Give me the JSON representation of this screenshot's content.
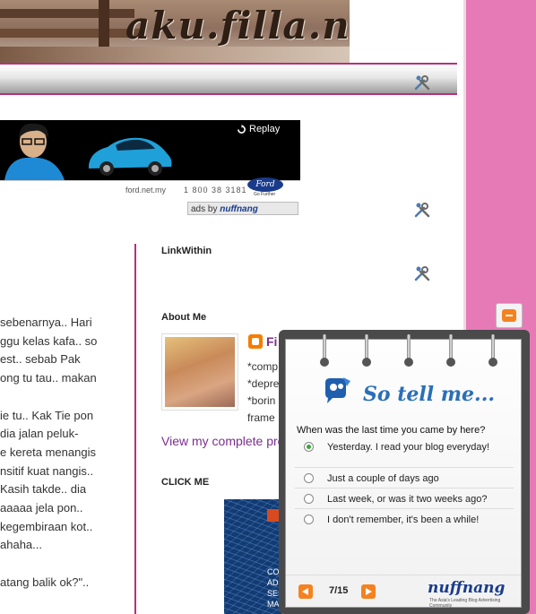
{
  "blog": {
    "title": "aku.filla.nie"
  },
  "ad": {
    "replay_label": "Replay",
    "site": "ford.net.my",
    "phone": "1 800 38 3181",
    "brand": "Ford",
    "tagline": "Go Further",
    "ads_by_prefix": "ads by",
    "ads_by_brand": "nuffnang"
  },
  "post": {
    "lines": [
      "sebenarnya.. Hari",
      "ggu kelas kafa.. so",
      "est.. sebab Pak",
      "ong tu tau.. makan",
      "",
      "ie tu.. Kak Tie pon",
      "dia jalan peluk-",
      "e kereta menangis",
      "nsitif kuat nangis..",
      "Kasih takde.. dia",
      "aaaaa jela pon..",
      "kegembiraan kot..",
      "ahaha...",
      "",
      "atang balik ok?\".."
    ]
  },
  "sidebar": {
    "linkwithin_title": "LinkWithin",
    "about_title": "About Me",
    "profile_name": "Fi",
    "about_lines": [
      "*comp",
      "*depre",
      "*borin",
      "frame"
    ],
    "view_profile": "View my complete pro",
    "clickme_title": "CLICK ME",
    "clickme_text": [
      "CO",
      "AD",
      "SES",
      "MA"
    ]
  },
  "poll": {
    "title": "So tell me...",
    "question": "When was the last time you came by here?",
    "options": [
      {
        "label": "Yesterday. I read your blog everyday!",
        "selected": true
      },
      {
        "label": "Just a couple of days ago",
        "selected": false
      },
      {
        "label": "Last week, or was it two weeks ago?",
        "selected": false
      },
      {
        "label": "I don't remember, it's been a while!",
        "selected": false
      }
    ],
    "page": "7/15",
    "brand": "nuffnang",
    "brand_sub": "The Asia's Leading Blog Advertising Community"
  },
  "colors": {
    "accent": "#b5307d",
    "link": "#7b2e8e",
    "pink_background": "#e57ab6",
    "nuffnang_orange": "#f58220"
  }
}
